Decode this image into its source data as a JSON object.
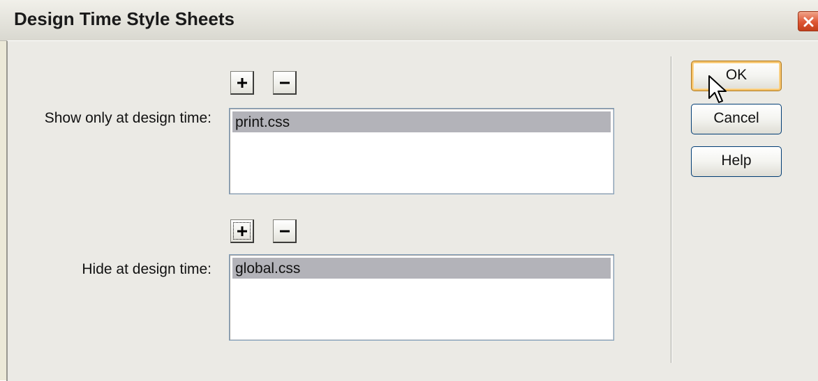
{
  "dialog": {
    "title": "Design Time Style Sheets"
  },
  "show_section": {
    "label": "Show only at design time:",
    "add_symbol": "+",
    "remove_symbol": "−",
    "items": [
      "print.css"
    ]
  },
  "hide_section": {
    "label": "Hide at design time:",
    "add_symbol": "+",
    "remove_symbol": "−",
    "items": [
      "global.css"
    ]
  },
  "buttons": {
    "ok": "OK",
    "cancel": "Cancel",
    "help": "Help"
  },
  "icons": {
    "close": "close-icon",
    "plus": "plus-icon",
    "minus": "minus-icon",
    "cursor": "mouse-pointer-icon"
  },
  "colors": {
    "selection": "#b3b3b9",
    "default_button_glow": "#f5c26a",
    "close_button": "#de5634"
  }
}
